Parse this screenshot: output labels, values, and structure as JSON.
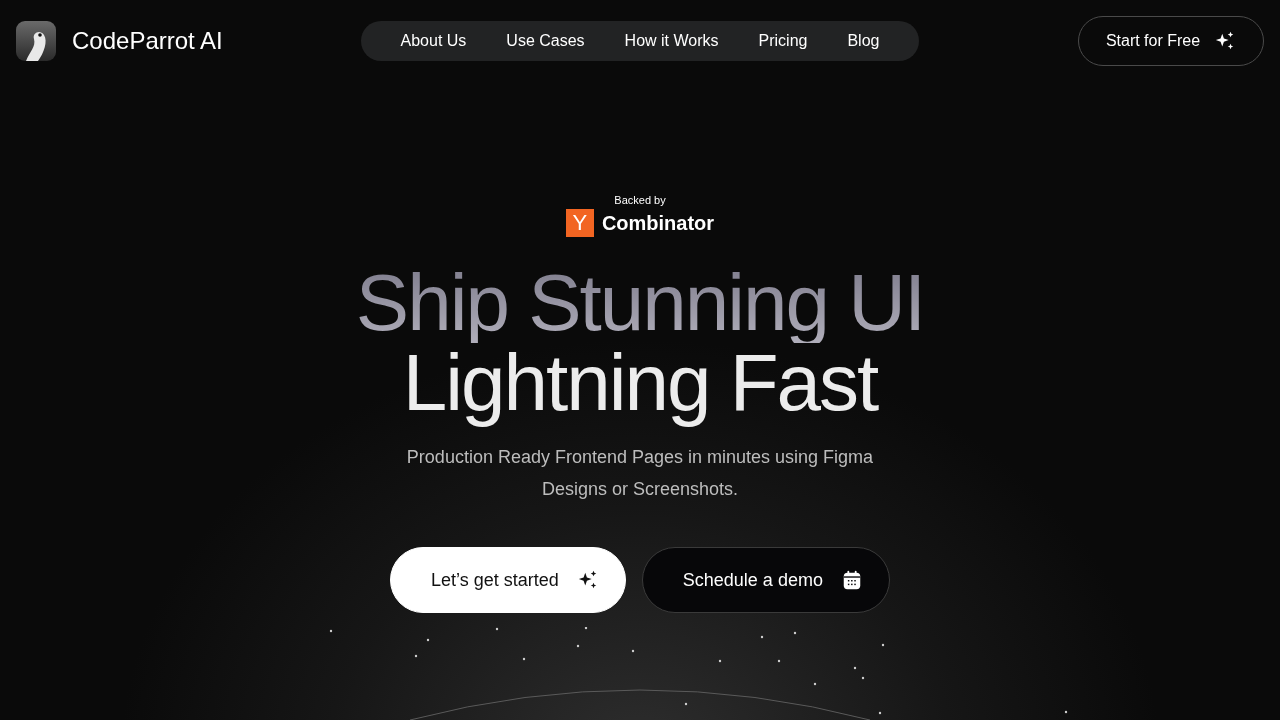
{
  "brand": {
    "name": "CodeParrot AI"
  },
  "nav": {
    "items": [
      "About Us",
      "Use Cases",
      "How it Works",
      "Pricing",
      "Blog"
    ]
  },
  "header_cta": {
    "label": "Start for Free"
  },
  "backer": {
    "caption": "Backed by",
    "logo_letter": "Y",
    "logo_text": "Combinator"
  },
  "hero": {
    "title_line_1": "Ship Stunning UI",
    "title_line_2": "Lightning Fast",
    "subtitle": "Production Ready Frontend Pages in minutes using Figma Designs or Screenshots."
  },
  "actions": [
    {
      "label": "Let’s get started",
      "kind": "primary"
    },
    {
      "label": "Schedule a demo",
      "kind": "secondary"
    }
  ]
}
